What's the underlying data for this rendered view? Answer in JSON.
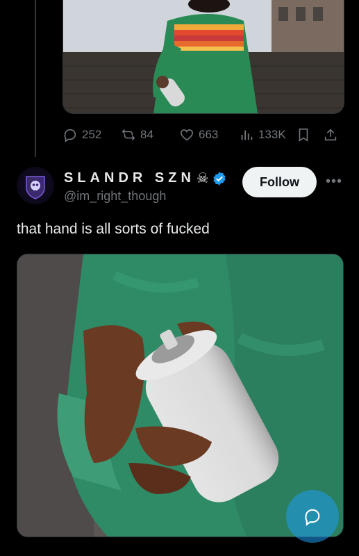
{
  "previous_post": {
    "stats": {
      "replies": "252",
      "reposts": "84",
      "likes": "663",
      "views": "133K"
    }
  },
  "post": {
    "display_name": "SLANDR SZN",
    "name_emoji": "☠",
    "handle": "@im_right_though",
    "follow_label": "Follow",
    "text": "that hand is all sorts of fucked",
    "verified": true
  },
  "colors": {
    "background": "#000000",
    "text_primary": "#e7e9ea",
    "text_secondary": "#71767b",
    "verified_blue": "#1d9bf0",
    "follow_bg": "#eff3f4"
  },
  "icons": {
    "reply": "reply-icon",
    "repost": "repost-icon",
    "like": "heart-icon",
    "views": "views-icon",
    "bookmark": "bookmark-icon",
    "share": "share-icon",
    "verified": "verified-badge-icon",
    "more": "more-icon",
    "compose_reply": "reply-fab-icon"
  }
}
